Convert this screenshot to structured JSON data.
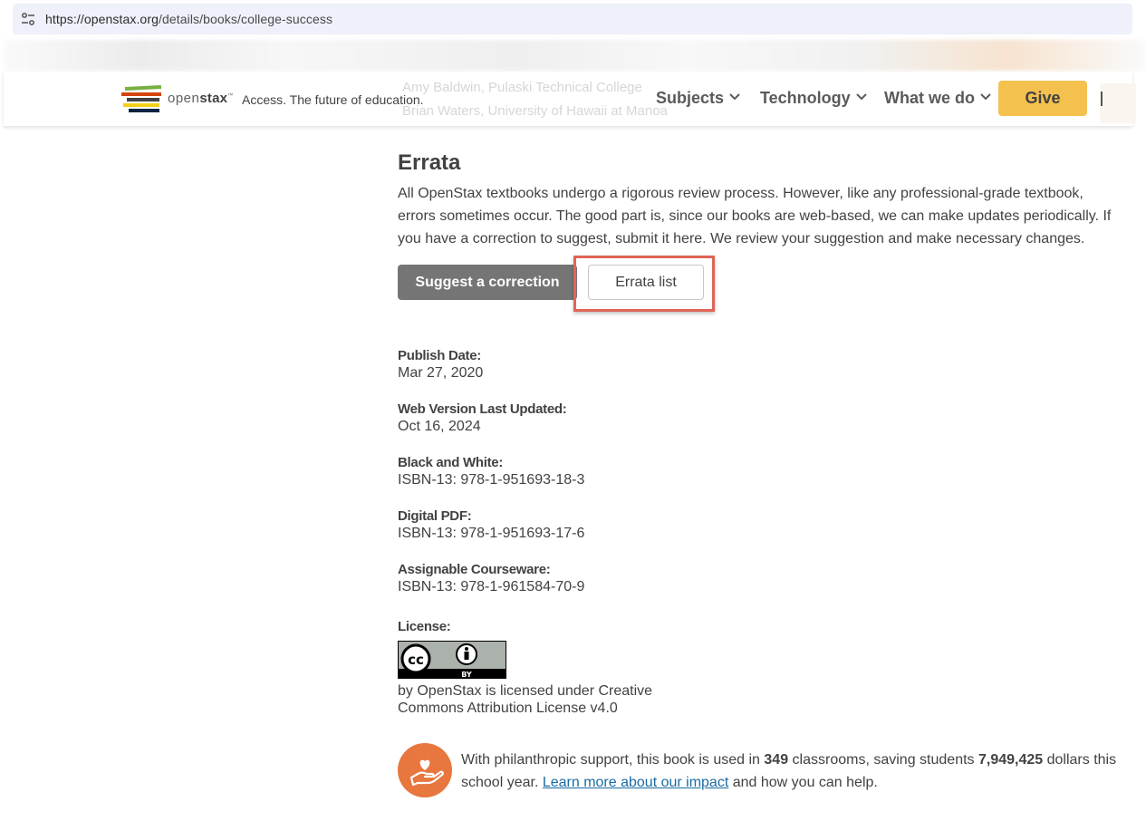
{
  "browser": {
    "url_host": "https://openstax.org",
    "url_path": "/details/books/college-success"
  },
  "header": {
    "brand_light": "open",
    "brand_bold": "stax",
    "brand_tm": "™",
    "tagline": "Access. The future of education.",
    "ghost_line1": "Amy Baldwin, Pulaski Technical College",
    "ghost_line2": "Brian Waters, University of Hawaii at Manoa",
    "nav": [
      {
        "label": "Subjects"
      },
      {
        "label": "Technology"
      },
      {
        "label": "What we do"
      }
    ],
    "give_label": "Give",
    "colors": {
      "give": "#f4c04e"
    }
  },
  "errata": {
    "title": "Errata",
    "description": "All OpenStax textbooks undergo a rigorous review process. However, like any professional-grade textbook, errors sometimes occur. The good part is, since our books are web-based, we can make updates periodically. If you have a correction to suggest, submit it here. We review your suggestion and make necessary changes.",
    "suggest_label": "Suggest a correction",
    "list_label": "Errata list",
    "highlight_color": "#e06455"
  },
  "details": [
    {
      "label": "Publish Date:",
      "value": "Mar 27, 2020"
    },
    {
      "label": "Web Version Last Updated:",
      "value": "Oct 16, 2024"
    },
    {
      "label": "Black and White:",
      "value": "ISBN-13: 978-1-951693-18-3"
    },
    {
      "label": "Digital PDF:",
      "value": "ISBN-13: 978-1-951693-17-6"
    },
    {
      "label": "Assignable Courseware:",
      "value": "ISBN-13: 978-1-961584-70-9"
    }
  ],
  "license": {
    "label": "License:",
    "badge_cc": "cc",
    "badge_by": "BY",
    "text": "by OpenStax is licensed under Creative Commons Attribution License v4.0"
  },
  "impact": {
    "text_before": "With philanthropic support, this book is used in ",
    "classrooms": "349",
    "text_mid": " classrooms, saving students ",
    "savings": "7,949,425",
    "text_after": " dollars this school year. ",
    "link": "Learn more about our impact",
    "text_end": " and how you can help.",
    "icon": "heart-hand-icon",
    "color": "#e8763f"
  }
}
